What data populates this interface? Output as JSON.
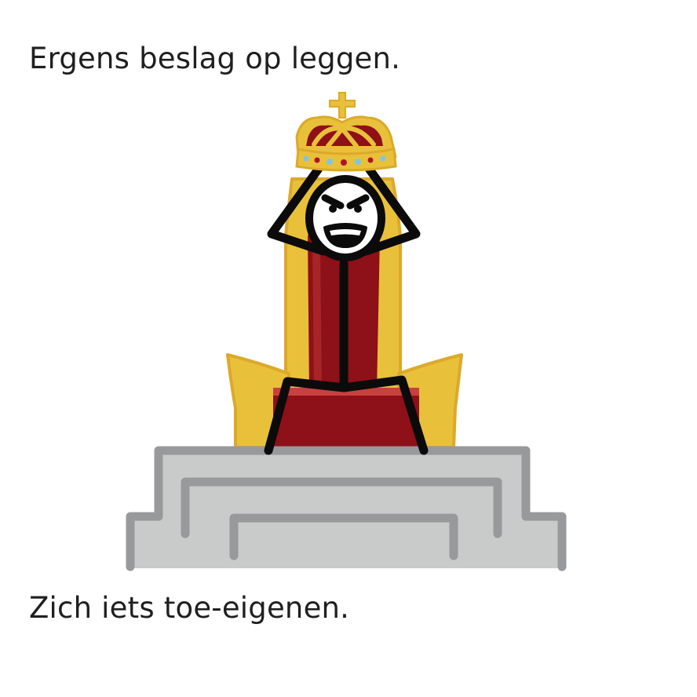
{
  "captions": {
    "top": "Ergens beslag op leggen.",
    "bottom": "Zich iets toe-eigenen."
  },
  "illustration": {
    "subjects": [
      "stick-figure",
      "crown",
      "throne",
      "stone-steps"
    ],
    "colors": {
      "gold": "#e9c03a",
      "gold_dark": "#dca92a",
      "velvet_red": "#8e1018",
      "velvet_red_light": "#c94040",
      "stone_fill": "#c9caca",
      "stone_outline": "#98999b",
      "ink": "#0b0b0b",
      "jewel_red": "#b0122a",
      "jewel_blue": "#7fc6e6"
    }
  }
}
